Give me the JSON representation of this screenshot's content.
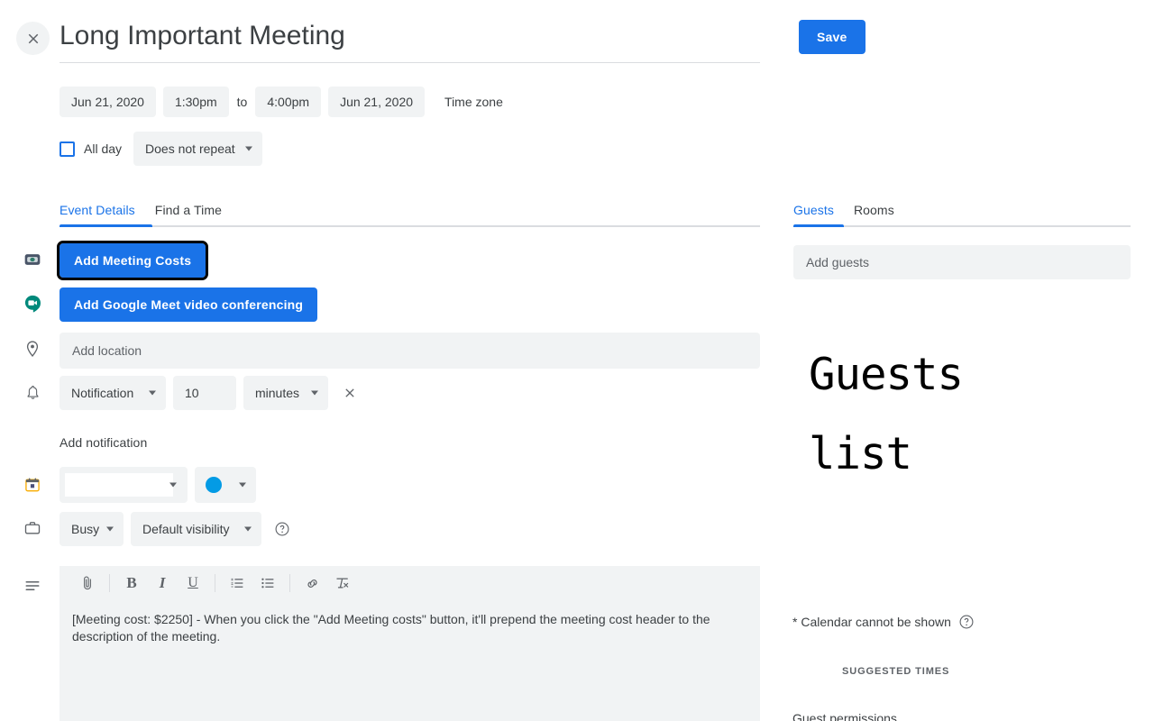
{
  "window": {
    "close_icon": "close-icon"
  },
  "event": {
    "title": "Long Important Meeting",
    "start_date": "Jun 21, 2020",
    "start_time": "1:30pm",
    "to_word": "to",
    "end_time": "4:00pm",
    "end_date": "Jun 21, 2020",
    "time_zone_label": "Time zone",
    "all_day_label": "All day",
    "all_day_checked": false,
    "repeat_value": "Does not repeat"
  },
  "tabs": {
    "event_details": "Event Details",
    "find_a_time": "Find a Time",
    "active": "Event Details"
  },
  "details": {
    "meeting_costs_button": "Add Meeting Costs",
    "meet_button": "Add Google Meet video conferencing",
    "location_placeholder": "Add location",
    "notification_type": "Notification",
    "notification_amount": "10",
    "notification_unit": "minutes",
    "add_notification_label": "Add notification",
    "calendar_value": "",
    "color_value": "",
    "color_hex": "#039be5",
    "busy_value": "Busy",
    "visibility_value": "Default visibility"
  },
  "editor": {
    "toolbar": [
      {
        "name": "attach-icon",
        "label": "Attach file"
      },
      {
        "name": "bold-icon",
        "label": "Bold"
      },
      {
        "name": "italic-icon",
        "label": "Italic"
      },
      {
        "name": "underline-icon",
        "label": "Underline"
      },
      {
        "name": "numbered-list-icon",
        "label": "Numbered list"
      },
      {
        "name": "bulleted-list-icon",
        "label": "Bulleted list"
      },
      {
        "name": "link-icon",
        "label": "Insert link"
      },
      {
        "name": "remove-formatting-icon",
        "label": "Remove formatting"
      }
    ],
    "description": "[Meeting cost: $2250] - When you click the \"Add Meeting costs\" button, it'll prepend the meeting cost header to the description of the meeting."
  },
  "right": {
    "save_label": "Save",
    "tab_guests": "Guests",
    "tab_rooms": "Rooms",
    "active_tab": "Guests",
    "add_guests_placeholder": "Add guests",
    "guests_overlay_line1": "Guests",
    "guests_overlay_line2": "list",
    "calendar_note": "* Calendar cannot be shown",
    "suggested_times": "SUGGESTED TIMES",
    "guest_permissions": "Guest permissions"
  },
  "colors": {
    "accent_blue": "#1a73e8",
    "pill_gray": "#f1f3f4",
    "text": "#3c4043",
    "muted": "#5f6368",
    "meet_green": "#00897b",
    "focus_outline": "#000000"
  }
}
